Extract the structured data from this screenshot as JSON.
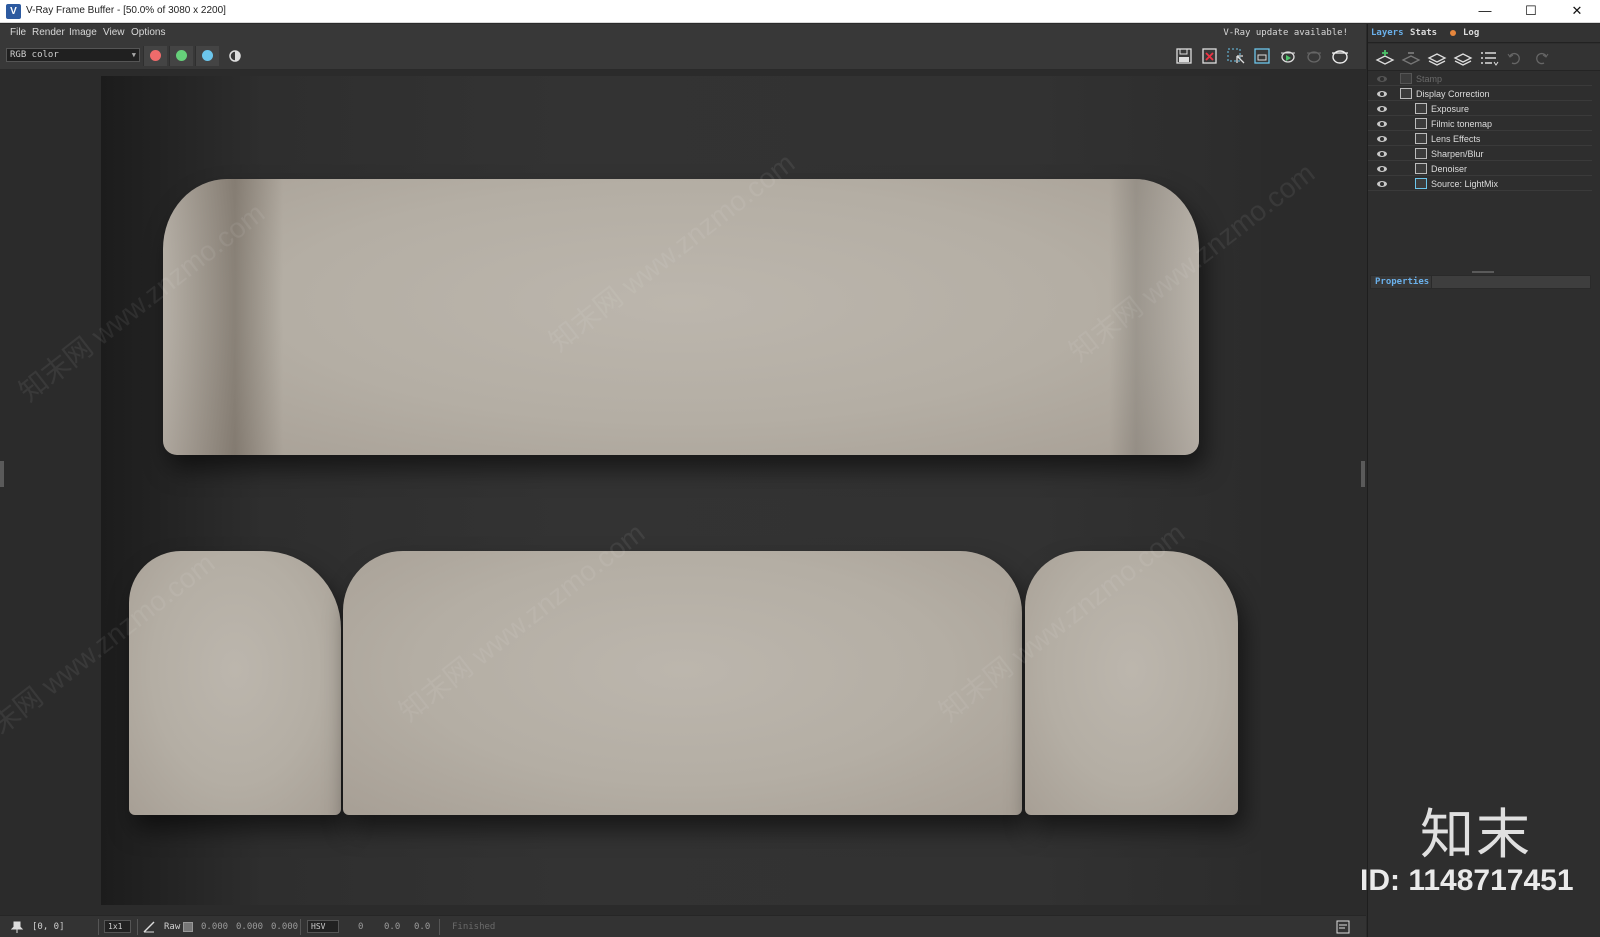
{
  "window": {
    "title": "V-Ray Frame Buffer - [50.0% of 3080 x 2200]",
    "minimize": "—",
    "maximize": "☐",
    "close": "✕",
    "app_icon": "V"
  },
  "menu": [
    "File",
    "Render",
    "Image",
    "View",
    "Options"
  ],
  "update_notice": "V-Ray update available!",
  "toolbar": {
    "channel": "RGB color",
    "channel_colors": {
      "red": "#ef6b6b",
      "green": "#66d07a",
      "blue": "#6cc6ec"
    }
  },
  "right_panel": {
    "tabs": [
      "Layers",
      "Stats",
      "Log"
    ],
    "layers": [
      {
        "label": "Stamp",
        "enabled": false
      },
      {
        "label": "Display Correction",
        "enabled": true
      },
      {
        "label": "Exposure",
        "enabled": true
      },
      {
        "label": "Filmic tonemap",
        "enabled": true
      },
      {
        "label": "Lens Effects",
        "enabled": true
      },
      {
        "label": "Sharpen/Blur",
        "enabled": true
      },
      {
        "label": "Denoiser",
        "enabled": true
      },
      {
        "label": "Source: LightMix",
        "enabled": true
      }
    ],
    "properties_label": "Properties"
  },
  "watermark": {
    "text": "知末网 www.znzmo.com",
    "brand": "知末",
    "id": "ID: 1148717451"
  },
  "statusbar": {
    "coords": "[0, 0]",
    "zoom": "1x1",
    "mode": "Raw",
    "rgb": [
      "0.000",
      "0.000",
      "0.000"
    ],
    "colorspace": "HSV",
    "hsv": [
      "0",
      "0.0",
      "0.0"
    ],
    "status": "Finished"
  }
}
